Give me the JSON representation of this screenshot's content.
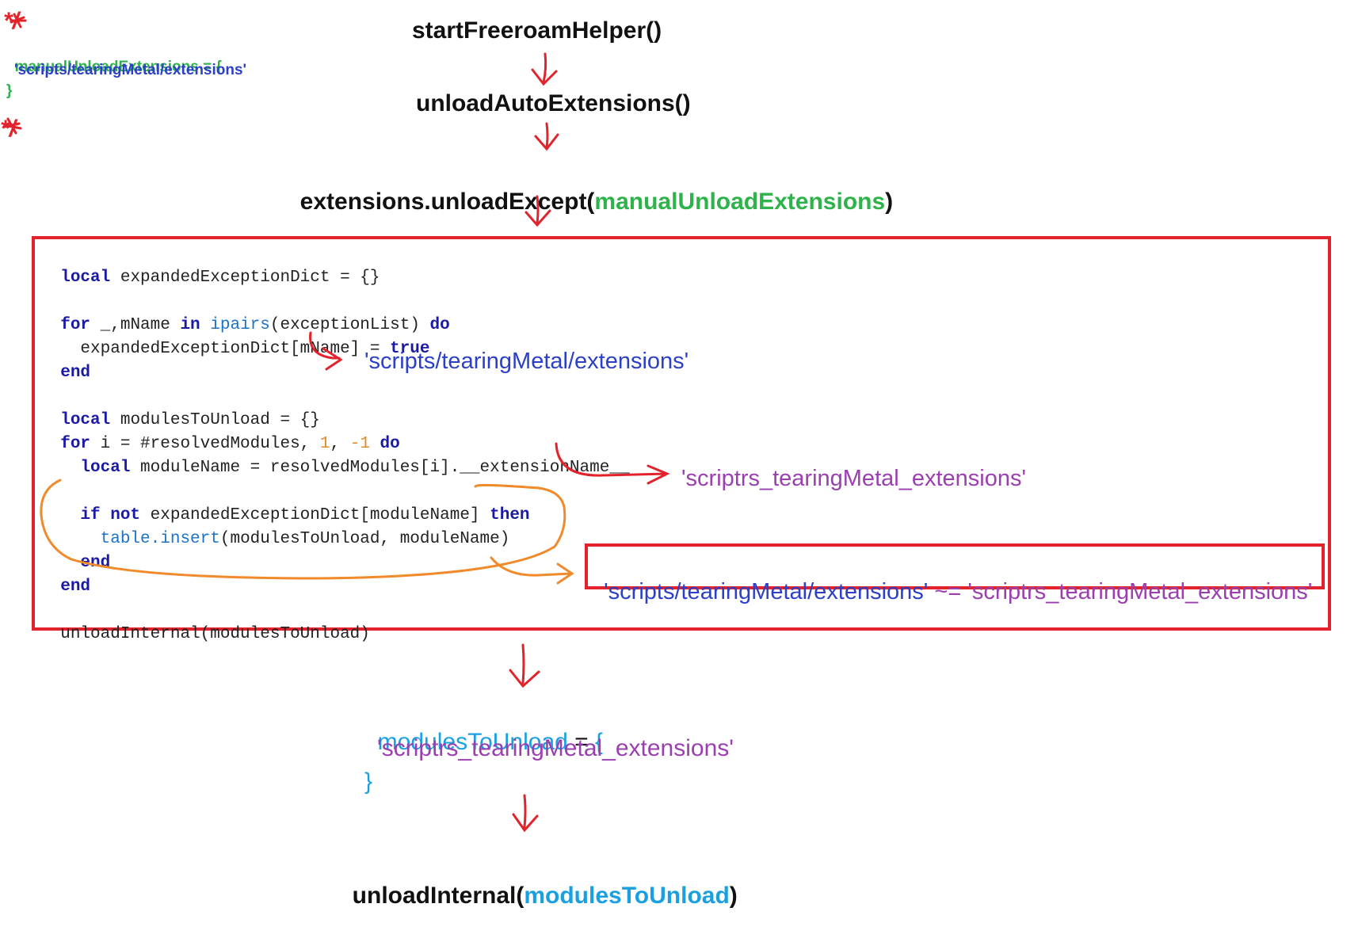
{
  "colors": {
    "arrow_red": "#e3232c",
    "circle_orange": "#f08a2a",
    "ident_green": "#2db34a",
    "ident_cyan": "#1aa0e0",
    "string_blue": "#2b3fc8",
    "string_purple": "#9b3fb0"
  },
  "note": {
    "open_mark": "*/",
    "line1_name": "manualUnloadExtensions",
    "line1_rest": " = {",
    "line2": "'scripts/tearingMetal/extensions'",
    "line3": "}",
    "close_mark": "*/"
  },
  "flow": {
    "step1": "startFreeroamHelper()",
    "step2": "unloadAutoExtensions()",
    "step3_prefix": "extensions.unloadExcept(",
    "step3_arg": "manualUnloadExtensions",
    "step3_suffix": ")"
  },
  "code": {
    "l1_kw": "local",
    "l1_rest": " expandedExceptionDict = {}",
    "l2_kw1": "for",
    "l2_mid": " _,mName ",
    "l2_kw2": "in",
    "l2_fn": " ipairs",
    "l2_args": "(exceptionList) ",
    "l2_kw3": "do",
    "l3_rest": "  expandedExceptionDict[mName] = ",
    "l3_kw": "true",
    "l4_kw": "end",
    "l5_kw": "local",
    "l5_rest": " modulesToUnload = {}",
    "l6_kw1": "for",
    "l6_rest": " i = #resolvedModules, ",
    "l6_n1": "1",
    "l6_sep": ", ",
    "l6_n2": "-1",
    "l6_kw2": " do",
    "l7_kw": "  local",
    "l7_rest": " moduleName = resolvedModules[i].__extensionName__",
    "l8_kw1": "  if not",
    "l8_rest": " expandedExceptionDict[moduleName] ",
    "l8_kw2": "then",
    "l9_fn": "    table.insert",
    "l9_rest": "(modulesToUnload, moduleName)",
    "l10_kw": "  end",
    "l11_kw": "end",
    "l12": "unloadInternal(modulesToUnload)"
  },
  "annotations": {
    "mname_value": "'scripts/tearingMetal/extensions'",
    "extname_value": "'scriptrs_tearingMetal_extensions'",
    "compare_left": "'scripts/tearingMetal/extensions'",
    "compare_op": " ~= ",
    "compare_right": "'scriptrs_tearingMetal_extensions'"
  },
  "result": {
    "name": "modulesToUnload",
    "eq": " = ",
    "open": "{",
    "item": "'scriptrs_tearingMetal_extensions'",
    "close": "}"
  },
  "final": {
    "prefix": "unloadInternal(",
    "arg": "modulesToUnload",
    "suffix": ")"
  }
}
